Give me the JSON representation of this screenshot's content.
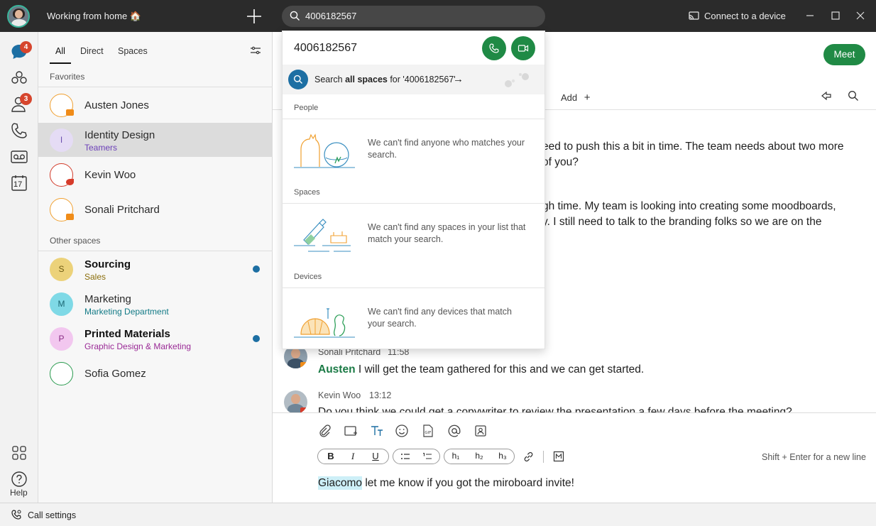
{
  "titlebar": {
    "status": "Working from home 🏠",
    "search_value": "4006182567",
    "connect_label": "Connect to a device"
  },
  "rail": {
    "messaging_badge": "4",
    "contacts_badge": "3",
    "calendar_day": "17",
    "help_label": "Help"
  },
  "panel": {
    "filters": [
      "All",
      "Direct",
      "Spaces"
    ],
    "favorites_label": "Favorites",
    "other_label": "Other spaces",
    "favorites": [
      {
        "name": "Austen Jones",
        "sub": ""
      },
      {
        "name": "Identity Design",
        "sub": "Teamers",
        "initial": "I"
      },
      {
        "name": "Kevin Woo",
        "sub": ""
      },
      {
        "name": "Sonali Pritchard",
        "sub": ""
      }
    ],
    "spaces": [
      {
        "name": "Sourcing",
        "sub": "Sales",
        "initial": "S"
      },
      {
        "name": "Marketing",
        "sub": "Marketing Department",
        "initial": "M"
      },
      {
        "name": "Printed Materials",
        "sub": "Graphic Design & Marketing",
        "initial": "P"
      },
      {
        "name": "Sofia Gomez",
        "sub": ""
      }
    ]
  },
  "dropdown": {
    "query": "4006182567",
    "search_prefix": "Search ",
    "search_bold": "all spaces",
    "search_suffix": " for '4006182567'",
    "people_label": "People",
    "people_empty": "We can't find anyone who matches your search.",
    "spaces_label": "Spaces",
    "spaces_empty": "We can't find any spaces in your list that match your search.",
    "devices_label": "Devices",
    "devices_empty": "We can't find any devices that match your search."
  },
  "main": {
    "meet_label": "Meet",
    "add_tab_label": "Add",
    "messages": [
      {
        "line1": "eed to push this a bit in time. The team needs about two more",
        "line2": "of you?"
      },
      {
        "line1": "gh time. My team is looking into creating some moodboards,",
        "line2": "y. I still need to talk to the branding folks so we are on the"
      },
      {
        "author": "Sonali Pritchard",
        "time": "11:58",
        "mention": "Austen",
        "text": " I will get the team gathered for this and we can get started."
      },
      {
        "author": "Kevin Woo",
        "time": "13:12",
        "text": "Do you think we could get a copywriter to review the presentation a few days before the meeting?"
      }
    ],
    "composer_hint": "Shift + Enter for a new line",
    "draft_mention": "Giacomo",
    "draft_text": " let me know if you got the miroboard invite!"
  },
  "bottombar": {
    "call_settings": "Call settings"
  },
  "colors": {
    "accent_green": "#208a45",
    "unread_blue": "#1d6fa3",
    "badge_red": "#d6452d"
  }
}
